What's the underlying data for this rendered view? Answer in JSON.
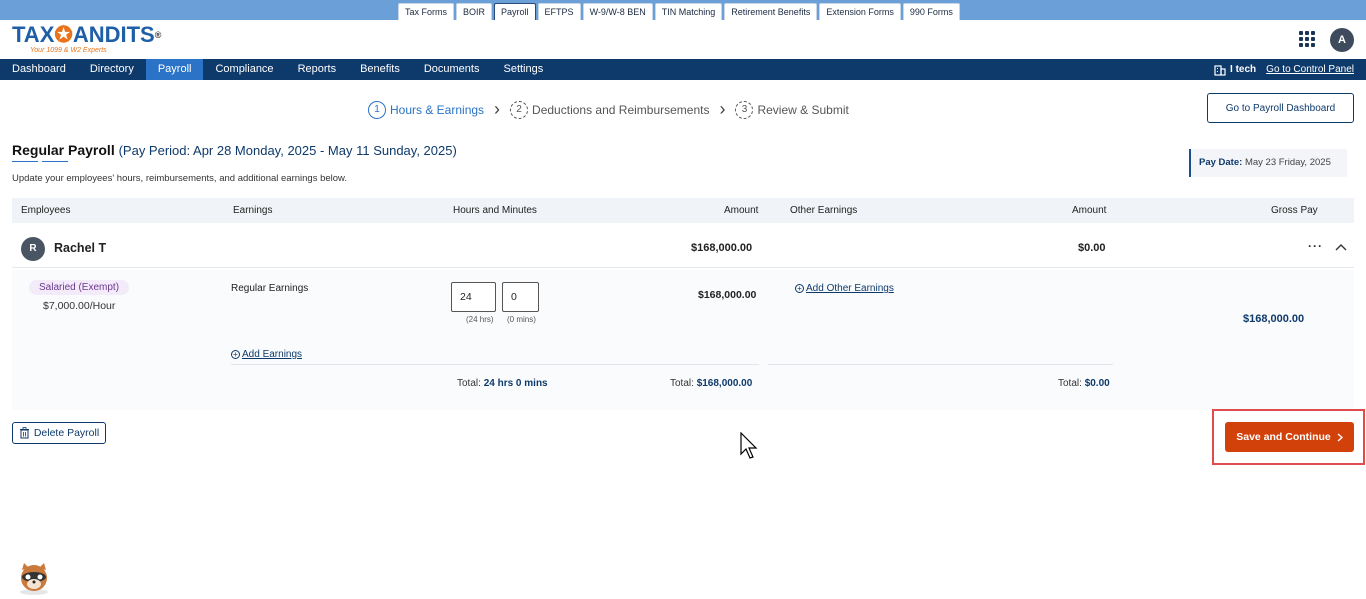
{
  "top_tabs": [
    "Tax Forms",
    "BOIR",
    "Payroll",
    "EFTPS",
    "W-9/W-8 BEN",
    "TIN Matching",
    "Retirement Benefits",
    "Extension Forms",
    "990 Forms"
  ],
  "top_tabs_active": "Payroll",
  "logo": {
    "brand_a": "TAX",
    "brand_b": "ANDITS",
    "registered": "®",
    "tagline": "Your 1099 & W2 Experts"
  },
  "user_avatar_initial": "A",
  "nav": {
    "items": [
      "Dashboard",
      "Directory",
      "Payroll",
      "Compliance",
      "Reports",
      "Benefits",
      "Documents",
      "Settings"
    ],
    "active": "Payroll",
    "org_name": "I tech",
    "control_panel_link": "Go to Control Panel"
  },
  "stepper": {
    "steps": [
      {
        "num": "1",
        "label": "Hours & Earnings",
        "active": true
      },
      {
        "num": "2",
        "label": "Deductions and Reimbursements",
        "active": false
      },
      {
        "num": "3",
        "label": "Review & Submit",
        "active": false
      }
    ]
  },
  "dashboard_button": "Go to Payroll Dashboard",
  "page": {
    "title": "Regular Payroll",
    "period": "(Pay Period: Apr 28 Monday, 2025 - May 11 Sunday, 2025)",
    "subtitle": "Update your employees' hours, reimbursements, and additional earnings below.",
    "pay_date_label": "Pay Date:",
    "pay_date_value": "May 23 Friday, 2025"
  },
  "table": {
    "headers": {
      "employees": "Employees",
      "earnings": "Earnings",
      "hours": "Hours and Minutes",
      "amount": "Amount",
      "other_earnings": "Other Earnings",
      "other_amount": "Amount",
      "gross_pay": "Gross Pay"
    },
    "employee": {
      "initial": "R",
      "name": "Rachel T",
      "amount": "$168,000.00",
      "other_amount": "$0.00",
      "more": "···",
      "type_badge": "Salaried (Exempt)",
      "rate": "$7,000.00/Hour",
      "earning_name": "Regular Earnings",
      "hours_value": "24",
      "minutes_value": "0",
      "hours_hint": "(24 hrs)",
      "minutes_hint": "(0 mins)",
      "earning_amount": "$168,000.00",
      "add_other_earnings": "Add Other Earnings",
      "add_earnings": "Add Earnings",
      "gross_pay": "$168,000.00",
      "total_hours_label": "Total:",
      "total_hours_value": "24 hrs 0 mins",
      "total_amount_label": "Total:",
      "total_amount_value": "$168,000.00",
      "total_other_label": "Total:",
      "total_other_value": "$0.00"
    }
  },
  "actions": {
    "delete_label": "Delete Payroll",
    "save_label": "Save and Continue"
  },
  "colors": {
    "nav_bg": "#0e3a6b",
    "nav_active": "#2a73c7",
    "save_button": "#d2410a",
    "highlight_box": "#e24b4b"
  }
}
